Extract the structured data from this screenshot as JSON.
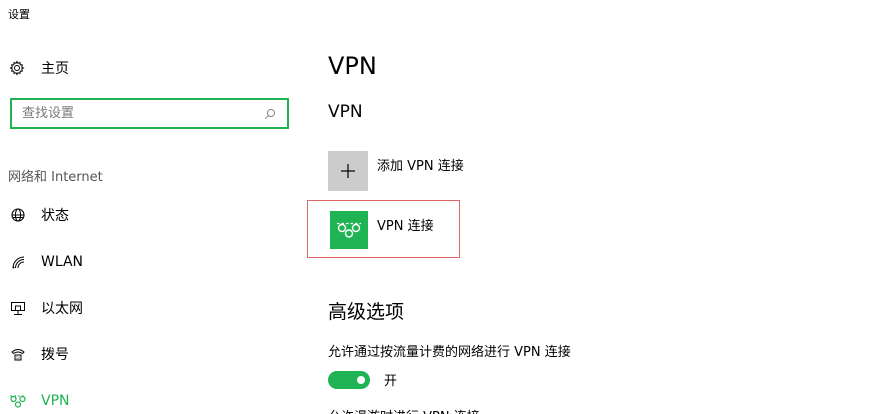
{
  "window": {
    "title": "设置"
  },
  "sidebar": {
    "home": {
      "label": "主页",
      "icon": "gear-icon"
    },
    "search": {
      "placeholder": "查找设置",
      "icon": "search-icon"
    },
    "group_header": "网络和 Internet",
    "items": [
      {
        "label": "状态",
        "icon": "globe-icon"
      },
      {
        "label": "WLAN",
        "icon": "wifi-icon"
      },
      {
        "label": "以太网",
        "icon": "ethernet-icon"
      },
      {
        "label": "拨号",
        "icon": "dialup-icon"
      },
      {
        "label": "VPN",
        "icon": "vpn-icon",
        "active": true
      }
    ]
  },
  "main": {
    "title": "VPN",
    "section_title": "VPN",
    "add_vpn": {
      "label": "添加 VPN 连接",
      "icon": "plus-icon"
    },
    "vpn_connection": {
      "label": "VPN 连接",
      "icon": "vpn-icon"
    },
    "advanced": {
      "title": "高级选项",
      "metered": {
        "label": "允许通过按流量计费的网络进行 VPN 连接",
        "toggle_state": "开",
        "on": true
      },
      "roaming": {
        "label": "允许漫游时进行 VPN 连接"
      }
    }
  },
  "colors": {
    "accent": "#1fb354",
    "tile_gray": "#cccccc",
    "highlight_border": "#e06666"
  }
}
